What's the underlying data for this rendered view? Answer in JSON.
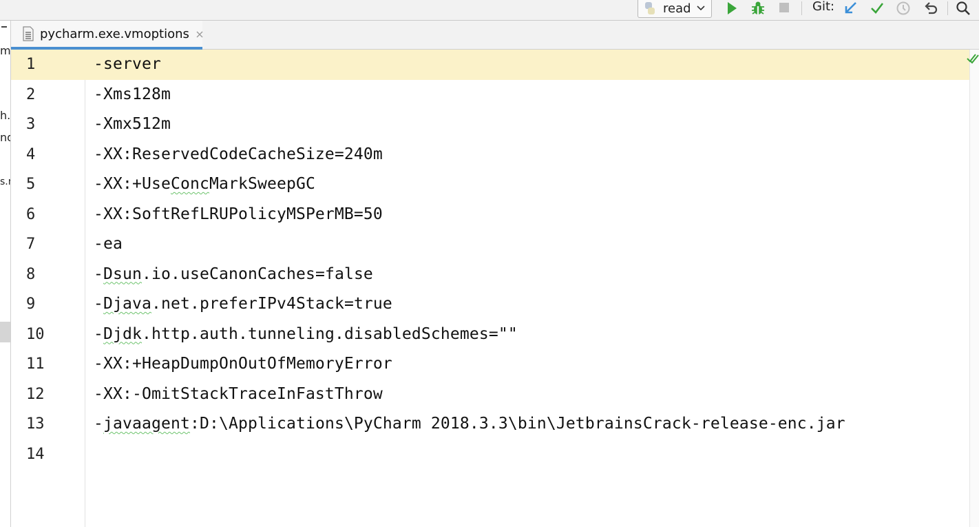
{
  "toolbar": {
    "run_config_label": "read",
    "git_label": "Git:",
    "colors": {
      "run": "#3aa53a",
      "debug": "#3aa53a",
      "stop": "#bfbfbf",
      "update": "#3b8fd8",
      "commit": "#3aa53a"
    }
  },
  "left_pane": {
    "fragments": [
      "m",
      "h.",
      "nd",
      "s.n"
    ]
  },
  "tabs": [
    {
      "label": "pycharm.exe.vmoptions",
      "active": true
    }
  ],
  "editor": {
    "current_line": 1,
    "lines": [
      {
        "num": "1",
        "text": "-server"
      },
      {
        "num": "2",
        "text": "-Xms128m"
      },
      {
        "num": "3",
        "text": "-Xmx512m"
      },
      {
        "num": "4",
        "text": "-XX:ReservedCodeCacheSize=240m"
      },
      {
        "num": "5",
        "pre": "-XX:+Use",
        "squig": "Conc",
        "post": "MarkSweepGC"
      },
      {
        "num": "6",
        "text": "-XX:SoftRefLRUPolicyMSPerMB=50"
      },
      {
        "num": "7",
        "text": "-ea"
      },
      {
        "num": "8",
        "pre": "-",
        "squig": "Dsun",
        "post": ".io.useCanonCaches=false"
      },
      {
        "num": "9",
        "pre": "-",
        "squig": "Djava",
        "post": ".net.preferIPv4Stack=true"
      },
      {
        "num": "10",
        "pre": "-",
        "squig": "Djdk",
        "post": ".http.auth.tunneling.disabledSchemes=\"\""
      },
      {
        "num": "11",
        "text": "-XX:+HeapDumpOnOutOfMemoryError"
      },
      {
        "num": "12",
        "text": "-XX:-OmitStackTraceInFastThrow"
      },
      {
        "num": "13",
        "pre": "-",
        "squig": "javaagent",
        "post": ":D:\\Applications\\PyCharm 2018.3.3\\bin\\JetbrainsCrack-release-enc.jar"
      },
      {
        "num": "14",
        "text": ""
      }
    ]
  }
}
